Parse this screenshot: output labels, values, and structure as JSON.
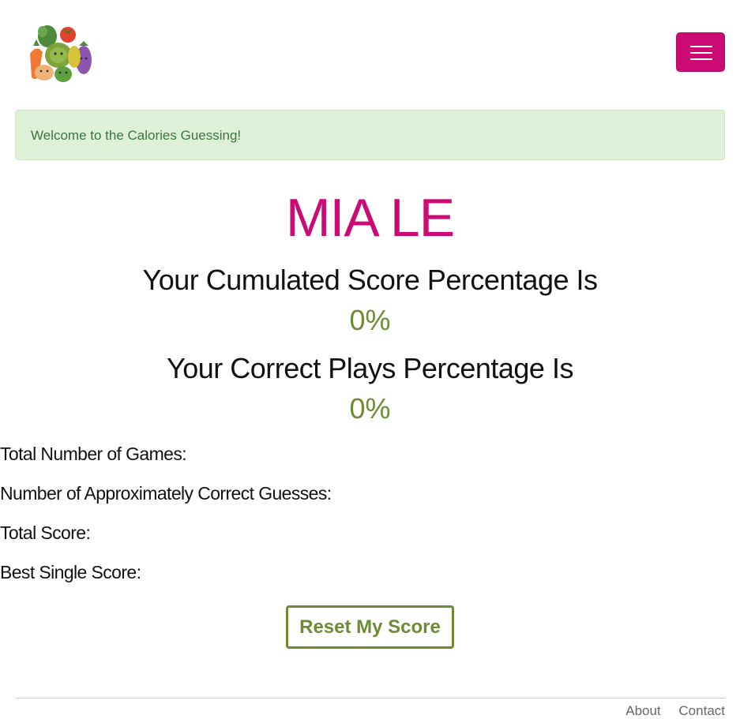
{
  "header": {
    "logo_icon": "vegetables-logo-icon",
    "menu_icon": "hamburger-menu-icon",
    "menu_button_color": "#cc0a73"
  },
  "alert": {
    "message": "Welcome to the Calories Guessing!"
  },
  "profile": {
    "name": "MIA LE",
    "cumulated_heading": "Your Cumulated Score Percentage Is",
    "cumulated_value": "0%",
    "correct_heading": "Your Correct Plays Percentage Is",
    "correct_value": "0%"
  },
  "stats": {
    "total_games_label": "Total Number of Games:",
    "approx_correct_label": "Number of Approximately Correct Guesses:",
    "total_score_label": "Total Score:",
    "best_score_label": "Best Single Score:"
  },
  "actions": {
    "reset_label": "Reset My Score"
  },
  "footer": {
    "about": "About",
    "contact": "Contact"
  },
  "colors": {
    "accent": "#cc0a73",
    "score": "#6f8a35",
    "alert_bg": "#dff0d8",
    "alert_text": "#3c763d"
  }
}
